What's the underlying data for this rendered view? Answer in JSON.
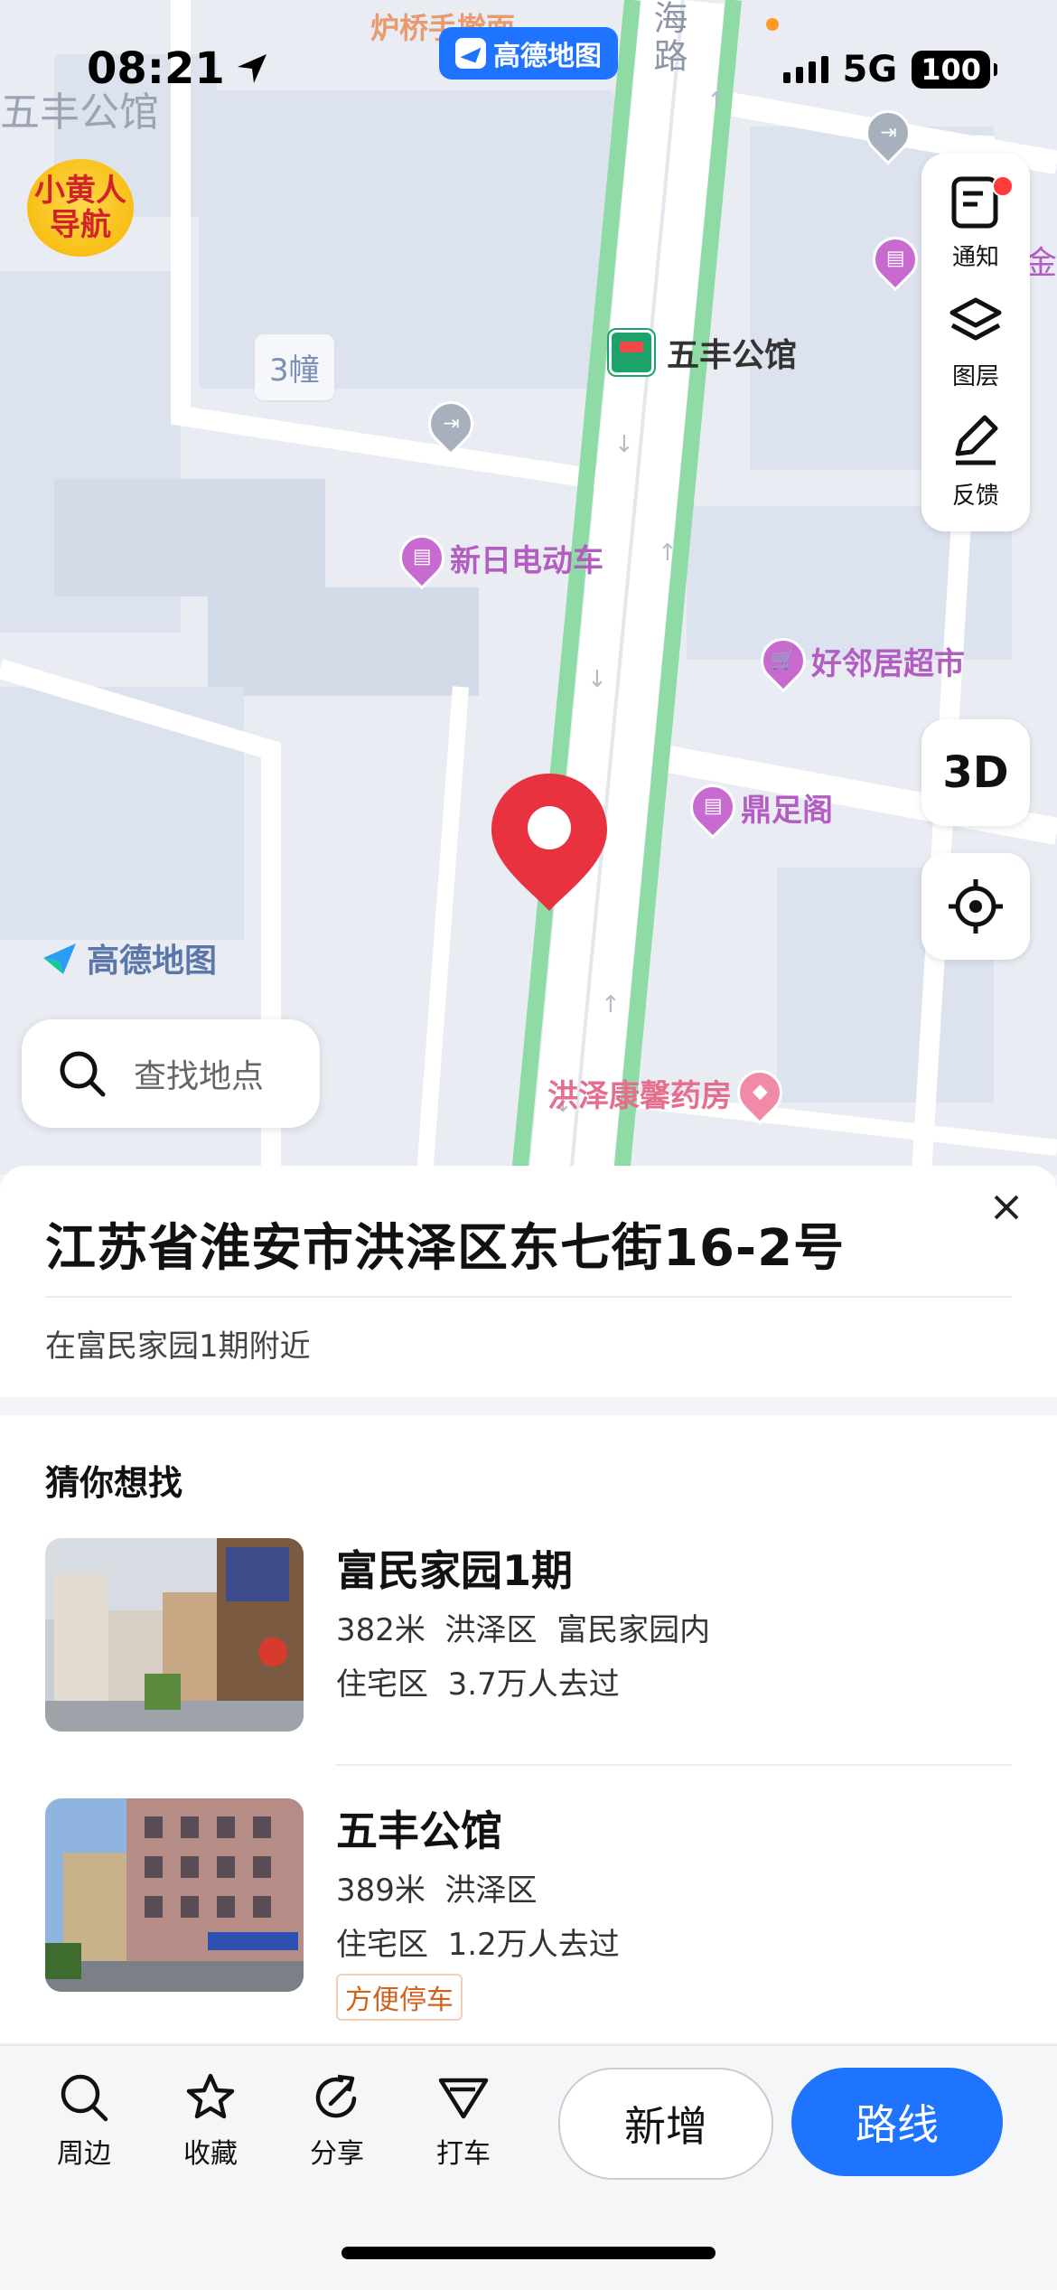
{
  "status_bar": {
    "time": "08:21",
    "network": "5G",
    "battery": "100"
  },
  "app_pill": {
    "label": "高德地图"
  },
  "map": {
    "top_label_cut": "炉桥手擀面",
    "road_label": "海路",
    "area_label": "五丰公馆",
    "badge": {
      "text": "小黄人导航"
    },
    "building_label": "3幢",
    "bus_stop": "五丰公馆",
    "right_edge_label": "金",
    "pois": [
      {
        "label": "新日电动车",
        "icon": "shop-icon"
      },
      {
        "label": "好邻居超市",
        "icon": "cart-icon"
      },
      {
        "label": "鼎足阁",
        "icon": "shop-icon"
      },
      {
        "label": "洪泽康馨药房",
        "icon": "tag-icon"
      }
    ],
    "watermark": "高德地图",
    "search_placeholder": "查找地点"
  },
  "toolbar": {
    "notify": "通知",
    "layers": "图层",
    "feedback": "反馈",
    "three_d": "3D"
  },
  "sheet": {
    "address": "江苏省淮安市洪泽区东七街16-2号",
    "nearby": "在富民家园1期附近",
    "section_title": "猜你想找",
    "places": [
      {
        "name": "富民家园1期",
        "distance": "382米",
        "district": "洪泽区",
        "extra": "富民家园内",
        "category": "住宅区",
        "visits": "3.7万人去过",
        "tag": ""
      },
      {
        "name": "五丰公馆",
        "distance": "389米",
        "district": "洪泽区",
        "extra": "",
        "category": "住宅区",
        "visits": "1.2万人去过",
        "tag": "方便停车"
      }
    ]
  },
  "bottom_bar": {
    "nearby": "周边",
    "favorite": "收藏",
    "share": "分享",
    "taxi": "打车",
    "new": "新增",
    "route": "路线"
  },
  "colors": {
    "accent": "#1f74ff",
    "pin": "#e8323f",
    "road_green": "#8edba6",
    "poi_purple": "#c76bd0"
  }
}
